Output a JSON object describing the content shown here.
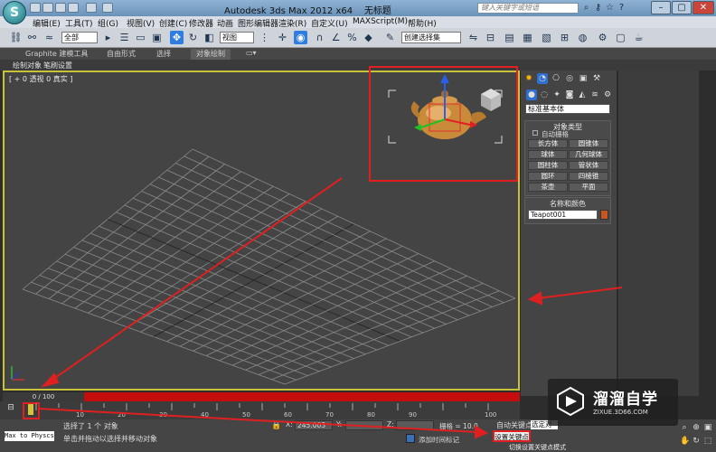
{
  "window": {
    "title": "Autodesk 3ds Max  2012 x64",
    "file_name": "无标题",
    "search_placeholder": "键入关键字或短语",
    "logo_letter": "S"
  },
  "menu": [
    "编辑(E)",
    "工具(T)",
    "组(G)",
    "视图(V)",
    "创建(C)",
    "修改器",
    "动画",
    "图形编辑器",
    "渲染(R)",
    "自定义(U)",
    "MAXScript(M)",
    "帮助(H)"
  ],
  "toolbar": {
    "filter_value": "全部",
    "view_dropdown": "视图",
    "selection_set_dropdown": "创建选择集"
  },
  "ribbon": {
    "tabs": [
      "Graphite 建模工具",
      "自由形式",
      "选择",
      "对象绘制"
    ],
    "active_tab": "对象绘制",
    "subtabs": [
      "绘制对象",
      "笔刷设置"
    ]
  },
  "viewport": {
    "label": "[ + 0 透视 0 真实 ]"
  },
  "command_panel": {
    "primitive_dropdown": "标准基本体",
    "object_type_title": "对象类型",
    "autogrid_label": "自动栅格",
    "object_buttons": [
      "长方体",
      "圆锥体",
      "球体",
      "几何球体",
      "圆柱体",
      "管状体",
      "圆环",
      "四棱锥",
      "茶壶",
      "平面"
    ],
    "name_color_title": "名称和颜色",
    "object_name": "Teapot001",
    "object_color": "#c8561e"
  },
  "timeline": {
    "frame_display": "0 / 100",
    "ticks": [
      "0",
      "10",
      "20",
      "30",
      "40",
      "50",
      "60",
      "70",
      "80",
      "90",
      "100"
    ]
  },
  "status": {
    "maxscript_text": "Max to Physcs C",
    "selection_status": "选择了 1 个 对象",
    "prompt": "单击并拖动以选择并移动对象",
    "x_label": "X:",
    "x_value": "245.003",
    "y_label": "Y:",
    "z_label": "Z:",
    "grid_label": "栅格 = 10.0",
    "auto_key": "自动关键点",
    "selected_dropdown": "选定对",
    "set_key": "设置关键点",
    "add_time_tag": "添加时间标记",
    "filter_tooltip": "切换设置关键点模式"
  },
  "watermark": {
    "title": "溜溜自学",
    "url": "ZIXUE.3D66.COM"
  }
}
